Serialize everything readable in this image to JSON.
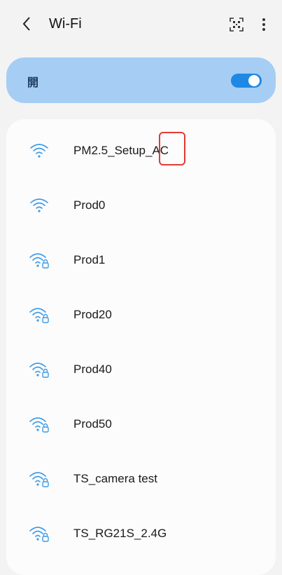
{
  "header": {
    "title": "Wi-Fi",
    "back_icon": "chevron-left-icon",
    "scan_icon": "qr-scan-icon",
    "more_icon": "more-vert-icon"
  },
  "wifi_toggle": {
    "label": "開",
    "state": "on"
  },
  "colors": {
    "accent": "#1e88e5",
    "toggle_card_bg": "#a6cdf3",
    "wifi_icon": "#3d9be9",
    "highlight": "#e53935"
  },
  "networks": [
    {
      "ssid": "PM2.5_Setup_AC",
      "secured": false
    },
    {
      "ssid": "Prod0",
      "secured": false
    },
    {
      "ssid": "Prod1",
      "secured": true
    },
    {
      "ssid": "Prod20",
      "secured": true
    },
    {
      "ssid": "Prod40",
      "secured": true
    },
    {
      "ssid": "Prod50",
      "secured": true
    },
    {
      "ssid": "TS_camera test",
      "secured": true
    },
    {
      "ssid": "TS_RG21S_2.4G",
      "secured": true
    }
  ]
}
